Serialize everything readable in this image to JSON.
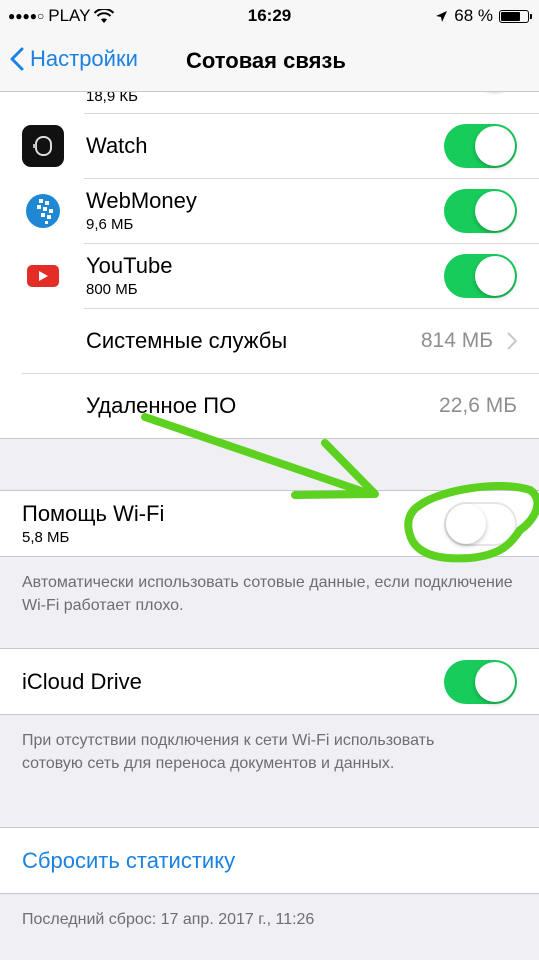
{
  "status_bar": {
    "signal_dots": "●●●●○",
    "carrier": "PLAY",
    "wifi_icon": "wifi-icon",
    "time": "16:29",
    "location_icon": "location-arrow-icon",
    "battery_percent": "68 %",
    "battery_level": 0.68
  },
  "nav": {
    "back_label": "Настройки",
    "title": "Сотовая связь"
  },
  "apps": [
    {
      "name": "",
      "size": "18,9 КБ",
      "icon": "app-icon-partial",
      "enabled": true
    },
    {
      "name": "Watch",
      "size": "",
      "icon": "watch-icon",
      "enabled": true
    },
    {
      "name": "WebMoney",
      "size": "9,6 МБ",
      "icon": "webmoney-icon",
      "enabled": true
    },
    {
      "name": "YouTube",
      "size": "800 МБ",
      "icon": "youtube-icon",
      "enabled": true
    }
  ],
  "system_services": {
    "label": "Системные службы",
    "value": "814 МБ"
  },
  "removed_apps": {
    "label": "Удаленное ПО",
    "value": "22,6 МБ"
  },
  "wifi_assist": {
    "label": "Помощь Wi-Fi",
    "size": "5,8 МБ",
    "enabled": false,
    "footer": "Автоматически использовать сотовые данные, если подключение Wi-Fi работает плохо."
  },
  "icloud_drive": {
    "label": "iCloud Drive",
    "enabled": true,
    "footer": "При отсутствии подключения к сети Wi-Fi использовать сотовую сеть для переноса документов и данных."
  },
  "reset": {
    "label": "Сбросить статистику",
    "footer": "Последний сброс: 17 апр. 2017 г., 11:26"
  },
  "colors": {
    "accent": "#1a82e2",
    "toggle_on": "#17cc5b",
    "annotation": "#5cd11f"
  }
}
